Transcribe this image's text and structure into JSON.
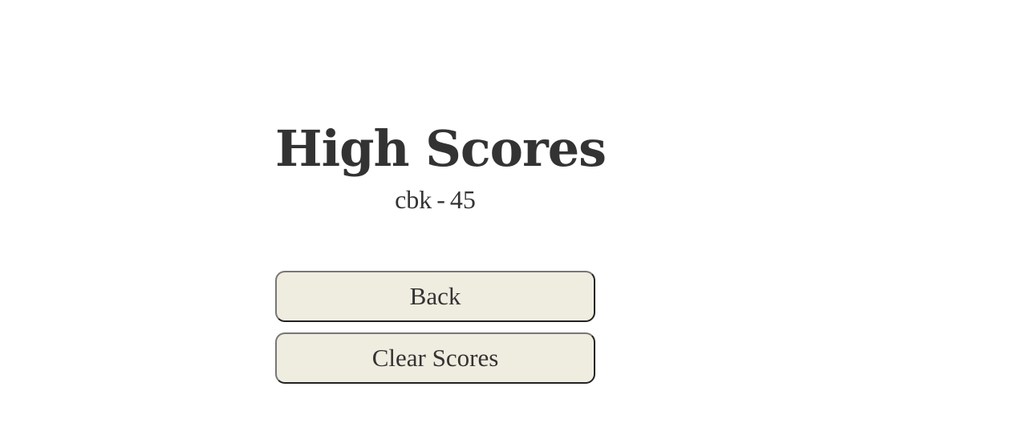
{
  "screen": {
    "title": "High Scores"
  },
  "high_scores": [
    {
      "name": "cbk",
      "separator": "-",
      "score": "45"
    }
  ],
  "buttons": {
    "back_label": "Back",
    "clear_scores_label": "Clear Scores"
  },
  "colors": {
    "background": "#ffffff",
    "text": "#333333",
    "button_fill": "#efece0",
    "button_border": "#222222"
  }
}
